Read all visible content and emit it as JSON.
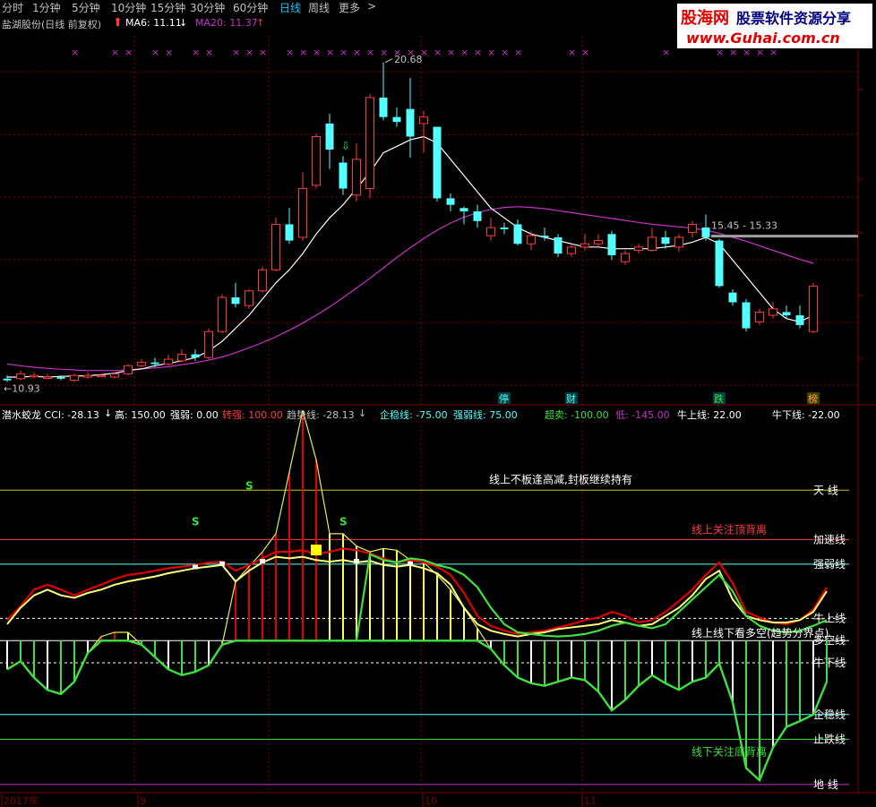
{
  "tabs": {
    "items": [
      {
        "label": "分时",
        "color": "#c0c0c0"
      },
      {
        "label": "1分钟",
        "color": "#c0c0c0"
      },
      {
        "label": "5分钟",
        "color": "#c0c0c0"
      },
      {
        "label": "10分钟",
        "color": "#c0c0c0"
      },
      {
        "label": "15分钟",
        "color": "#c0c0c0"
      },
      {
        "label": "30分钟",
        "color": "#c0c0c0"
      },
      {
        "label": "60分钟",
        "color": "#c0c0c0"
      },
      {
        "label": "日线",
        "color": "#00c8ff"
      },
      {
        "label": "周线",
        "color": "#c0c0c0"
      },
      {
        "label": "更多",
        "color": "#c0c0c0"
      },
      {
        "label": ">",
        "color": "#c0c0c0"
      }
    ]
  },
  "stock": {
    "title": "盐湖股份(日线 前复权)",
    "ma6_label": "MA6: 11.11",
    "ma20_label": "MA20: 11.37",
    "arrow_down": "↓",
    "arrow_up": "↑"
  },
  "logo": {
    "name": "股海网",
    "slogan": "股票软件资源分享",
    "url": "www.Guhai.com.cn"
  },
  "colors": {
    "up": "#ff3c3c",
    "down": "#54ffff",
    "ma6": "#ffffff",
    "ma20": "#c832c8",
    "grid": "#800000",
    "cross_marker": "#c832c8",
    "hist_red": "#e00000",
    "hist_yellow": "#ffff50",
    "hist_green": "#40e040",
    "hist_white": "#ffffff"
  },
  "chart_data": [
    {
      "type": "candlestick",
      "title": "盐湖股份(日线 前复权)",
      "ylim": [
        10.2,
        21.5
      ],
      "high_annotation": "20.68",
      "low_annotation": "10.93",
      "range_annotation": "15.45 - 15.33",
      "event_tags": [
        "停",
        "财",
        "跌",
        "榜"
      ],
      "candles": [
        {
          "o": 10.95,
          "c": 10.9,
          "h": 11.05,
          "l": 10.85
        },
        {
          "o": 10.95,
          "c": 11.1,
          "h": 11.2,
          "l": 10.9
        },
        {
          "o": 11.05,
          "c": 11.05,
          "h": 11.15,
          "l": 10.95
        },
        {
          "o": 11.0,
          "c": 11.0,
          "h": 11.1,
          "l": 10.95
        },
        {
          "o": 11.0,
          "c": 10.95,
          "h": 11.05,
          "l": 10.9
        },
        {
          "o": 10.9,
          "c": 11.05,
          "h": 11.1,
          "l": 10.85
        },
        {
          "o": 11.0,
          "c": 11.05,
          "h": 11.15,
          "l": 10.95
        },
        {
          "o": 11.05,
          "c": 11.05,
          "h": 11.1,
          "l": 11.0
        },
        {
          "o": 11.0,
          "c": 11.1,
          "h": 11.15,
          "l": 10.95
        },
        {
          "o": 11.1,
          "c": 11.35,
          "h": 11.4,
          "l": 11.05
        },
        {
          "o": 11.35,
          "c": 11.45,
          "h": 11.55,
          "l": 11.3
        },
        {
          "o": 11.45,
          "c": 11.4,
          "h": 11.6,
          "l": 11.3
        },
        {
          "o": 11.4,
          "c": 11.55,
          "h": 11.7,
          "l": 11.35
        },
        {
          "o": 11.5,
          "c": 11.7,
          "h": 11.85,
          "l": 11.45
        },
        {
          "o": 11.7,
          "c": 11.6,
          "h": 11.85,
          "l": 11.5
        },
        {
          "o": 11.6,
          "c": 12.4,
          "h": 12.5,
          "l": 11.55
        },
        {
          "o": 12.4,
          "c": 13.45,
          "h": 13.55,
          "l": 12.35
        },
        {
          "o": 13.45,
          "c": 13.25,
          "h": 13.9,
          "l": 13.15
        },
        {
          "o": 13.2,
          "c": 13.65,
          "h": 13.7,
          "l": 13.1
        },
        {
          "o": 13.65,
          "c": 14.3,
          "h": 14.4,
          "l": 13.6
        },
        {
          "o": 14.3,
          "c": 15.7,
          "h": 15.9,
          "l": 14.25
        },
        {
          "o": 15.7,
          "c": 15.2,
          "h": 16.2,
          "l": 15.1
        },
        {
          "o": 15.3,
          "c": 16.8,
          "h": 17.3,
          "l": 15.2
        },
        {
          "o": 16.9,
          "c": 18.4,
          "h": 18.5,
          "l": 16.8
        },
        {
          "o": 18.8,
          "c": 18.0,
          "h": 19.1,
          "l": 17.4
        },
        {
          "o": 17.6,
          "c": 16.8,
          "h": 17.8,
          "l": 16.6
        },
        {
          "o": 16.6,
          "c": 17.7,
          "h": 18.2,
          "l": 16.4
        },
        {
          "o": 16.8,
          "c": 19.6,
          "h": 19.7,
          "l": 16.5
        },
        {
          "o": 19.6,
          "c": 19.0,
          "h": 20.68,
          "l": 18.9
        },
        {
          "o": 19.0,
          "c": 18.85,
          "h": 19.3,
          "l": 18.7
        },
        {
          "o": 19.25,
          "c": 18.4,
          "h": 20.2,
          "l": 17.75
        },
        {
          "o": 18.8,
          "c": 19.0,
          "h": 19.2,
          "l": 17.9
        },
        {
          "o": 18.7,
          "c": 16.5,
          "h": 18.7,
          "l": 16.4
        },
        {
          "o": 16.5,
          "c": 16.3,
          "h": 16.65,
          "l": 16.1
        },
        {
          "o": 16.2,
          "c": 16.1,
          "h": 16.25,
          "l": 15.7
        },
        {
          "o": 16.1,
          "c": 15.8,
          "h": 16.3,
          "l": 15.6
        },
        {
          "o": 15.35,
          "c": 15.6,
          "h": 15.9,
          "l": 15.2
        },
        {
          "o": 15.6,
          "c": 15.55,
          "h": 15.75,
          "l": 15.4
        },
        {
          "o": 15.7,
          "c": 15.1,
          "h": 15.85,
          "l": 15.05
        },
        {
          "o": 15.1,
          "c": 15.35,
          "h": 15.5,
          "l": 14.9
        },
        {
          "o": 15.35,
          "c": 15.3,
          "h": 15.6,
          "l": 15.2
        },
        {
          "o": 15.3,
          "c": 14.8,
          "h": 15.4,
          "l": 14.7
        },
        {
          "o": 14.8,
          "c": 15.0,
          "h": 15.1,
          "l": 14.7
        },
        {
          "o": 15.0,
          "c": 15.1,
          "h": 15.4,
          "l": 14.9
        },
        {
          "o": 15.1,
          "c": 15.2,
          "h": 15.4,
          "l": 15.0
        },
        {
          "o": 15.4,
          "c": 14.75,
          "h": 15.5,
          "l": 14.6
        },
        {
          "o": 14.55,
          "c": 14.8,
          "h": 14.9,
          "l": 14.45
        },
        {
          "o": 14.9,
          "c": 15.0,
          "h": 15.1,
          "l": 14.8
        },
        {
          "o": 14.9,
          "c": 15.3,
          "h": 15.6,
          "l": 14.85
        },
        {
          "o": 15.3,
          "c": 15.1,
          "h": 15.5,
          "l": 14.95
        },
        {
          "o": 15.0,
          "c": 15.3,
          "h": 15.4,
          "l": 14.85
        },
        {
          "o": 15.45,
          "c": 15.7,
          "h": 15.8,
          "l": 15.3
        },
        {
          "o": 15.6,
          "c": 15.3,
          "h": 16.0,
          "l": 15.2
        },
        {
          "o": 15.2,
          "c": 13.8,
          "h": 15.25,
          "l": 13.75
        },
        {
          "o": 13.6,
          "c": 13.3,
          "h": 13.7,
          "l": 13.2
        },
        {
          "o": 13.3,
          "c": 12.5,
          "h": 13.4,
          "l": 12.4
        },
        {
          "o": 12.7,
          "c": 13.0,
          "h": 13.1,
          "l": 12.6
        },
        {
          "o": 12.9,
          "c": 13.1,
          "h": 13.3,
          "l": 12.8
        },
        {
          "o": 13.0,
          "c": 12.9,
          "h": 13.2,
          "l": 12.8
        },
        {
          "o": 12.9,
          "c": 12.6,
          "h": 13.2,
          "l": 12.5
        },
        {
          "o": 12.4,
          "c": 13.8,
          "h": 13.9,
          "l": 12.35
        }
      ],
      "ma6": [
        11.0,
        11.0,
        11.02,
        11.0,
        11.02,
        11.03,
        11.04,
        11.07,
        11.12,
        11.2,
        11.25,
        11.35,
        11.42,
        11.5,
        11.6,
        11.8,
        12.1,
        12.5,
        12.9,
        13.4,
        13.9,
        14.3,
        14.8,
        15.4,
        15.9,
        16.3,
        16.8,
        17.3,
        17.9,
        18.1,
        18.3,
        18.4,
        18.2,
        17.7,
        17.2,
        16.7,
        16.2,
        15.9,
        15.6,
        15.4,
        15.3,
        15.2,
        15.1,
        15.0,
        15.0,
        14.95,
        14.95,
        14.95,
        14.95,
        15.0,
        15.05,
        15.15,
        15.3,
        15.1,
        14.6,
        14.1,
        13.6,
        13.1,
        12.8,
        12.7,
        12.9
      ],
      "ma20": [
        11.4,
        11.35,
        11.3,
        11.27,
        11.24,
        11.22,
        11.2,
        11.2,
        11.2,
        11.22,
        11.25,
        11.28,
        11.32,
        11.38,
        11.44,
        11.52,
        11.62,
        11.75,
        11.9,
        12.06,
        12.24,
        12.44,
        12.66,
        12.9,
        13.16,
        13.44,
        13.74,
        14.04,
        14.36,
        14.68,
        14.98,
        15.26,
        15.52,
        15.74,
        15.92,
        16.06,
        16.16,
        16.22,
        16.24,
        16.22,
        16.18,
        16.12,
        16.06,
        16.0,
        15.94,
        15.88,
        15.82,
        15.76,
        15.7,
        15.66,
        15.62,
        15.58,
        15.52,
        15.42,
        15.3,
        15.18,
        15.04,
        14.9,
        14.76,
        14.62,
        14.5
      ]
    },
    {
      "type": "line",
      "title": "潜水蛟龙",
      "legend": {
        "cci": "潜水蛟龙  CCI: -28.13",
        "high": "高: 150.00",
        "strong_weak": "强弱: 0.00",
        "accel": "转强: 100.00",
        "trend": "趋势线: -28.13",
        "stable": "企稳线: -75.00",
        "strong_line": "强弱线: 75.00",
        "oversold": "超卖: -100.00",
        "low": "低: -145.00",
        "bull_up": "牛上线: 22.00",
        "bull_down": "牛下线: -22.00",
        "arrow": "↓"
      },
      "ylim": [
        -185,
        265
      ],
      "levels": [
        {
          "label": "天 线",
          "value": 183,
          "color": "#c8c800"
        },
        {
          "label": "加速线",
          "value": 123,
          "color": "#ff3c3c"
        },
        {
          "label": "强弱线",
          "value": 93,
          "color": "#54ffff"
        },
        {
          "label": "牛上线",
          "value": 27,
          "color": "#ffffff",
          "dashed": true
        },
        {
          "label": "多空线",
          "value": 0,
          "color": "#ffffff"
        },
        {
          "label": "牛下线",
          "value": -27,
          "color": "#ffffff",
          "dashed": true
        },
        {
          "label": "企稳线",
          "value": -90,
          "color": "#54ffff"
        },
        {
          "label": "止跌线",
          "value": -120,
          "color": "#40e040"
        },
        {
          "label": "地 线",
          "value": -175,
          "color": "#c832c8"
        }
      ],
      "annotations": [
        {
          "text": "线上不板逢高减,封板继续持有",
          "color": "#ffffff"
        },
        {
          "text": "线上关注顶背离",
          "color": "#ff3c3c"
        },
        {
          "text": "线上线下看多空(趋势分界点)",
          "color": "#ffffff"
        },
        {
          "text": "线下关注底背离",
          "color": "#40e040"
        }
      ],
      "s_marks": [
        "S",
        "S",
        "S"
      ],
      "axis_labels": [
        "2017年",
        "9",
        "10",
        "11"
      ],
      "cci": [
        -35,
        -25,
        -45,
        -60,
        -65,
        -50,
        -15,
        5,
        10,
        10,
        -5,
        -20,
        -35,
        -42,
        -38,
        -30,
        -5,
        72,
        90,
        108,
        130,
        205,
        280,
        220,
        130,
        130,
        115,
        108,
        112,
        110,
        98,
        95,
        80,
        62,
        40,
        15,
        -10,
        -30,
        -45,
        -52,
        -55,
        -50,
        -45,
        -48,
        -62,
        -85,
        -72,
        -55,
        -42,
        -52,
        -60,
        -50,
        -45,
        -28,
        -75,
        -155,
        -170,
        -130,
        -105,
        -98,
        -90,
        -50
      ],
      "ma_yellow": [
        20,
        40,
        55,
        62,
        55,
        52,
        58,
        62,
        68,
        72,
        75,
        78,
        82,
        85,
        88,
        90,
        92,
        72,
        85,
        95,
        102,
        100,
        102,
        98,
        96,
        98,
        95,
        97,
        92,
        90,
        92,
        88,
        82,
        68,
        40,
        20,
        12,
        8,
        5,
        8,
        10,
        14,
        16,
        18,
        20,
        25,
        22,
        18,
        20,
        30,
        40,
        55,
        75,
        85,
        50,
        30,
        25,
        22,
        22,
        25,
        35,
        60
      ],
      "ma_red": [
        25,
        42,
        62,
        68,
        62,
        55,
        62,
        68,
        75,
        80,
        82,
        85,
        88,
        90,
        92,
        95,
        96,
        85,
        92,
        100,
        108,
        108,
        110,
        105,
        108,
        112,
        110,
        106,
        100,
        95,
        98,
        95,
        90,
        80,
        58,
        30,
        18,
        12,
        8,
        10,
        12,
        16,
        20,
        25,
        28,
        35,
        30,
        22,
        25,
        35,
        48,
        62,
        80,
        95,
        70,
        35,
        28,
        22,
        20,
        25,
        38,
        65
      ],
      "ma_green": [
        0,
        0,
        0,
        0,
        0,
        0,
        0,
        0,
        0,
        0,
        0,
        0,
        0,
        0,
        0,
        0,
        0,
        0,
        0,
        0,
        0,
        0,
        0,
        0,
        0,
        0,
        0,
        105,
        98,
        95,
        100,
        98,
        92,
        88,
        80,
        65,
        40,
        20,
        10,
        8,
        6,
        5,
        6,
        8,
        12,
        18,
        22,
        18,
        15,
        20,
        35,
        50,
        65,
        80,
        60,
        30,
        18,
        12,
        10,
        12,
        18,
        25
      ]
    }
  ]
}
